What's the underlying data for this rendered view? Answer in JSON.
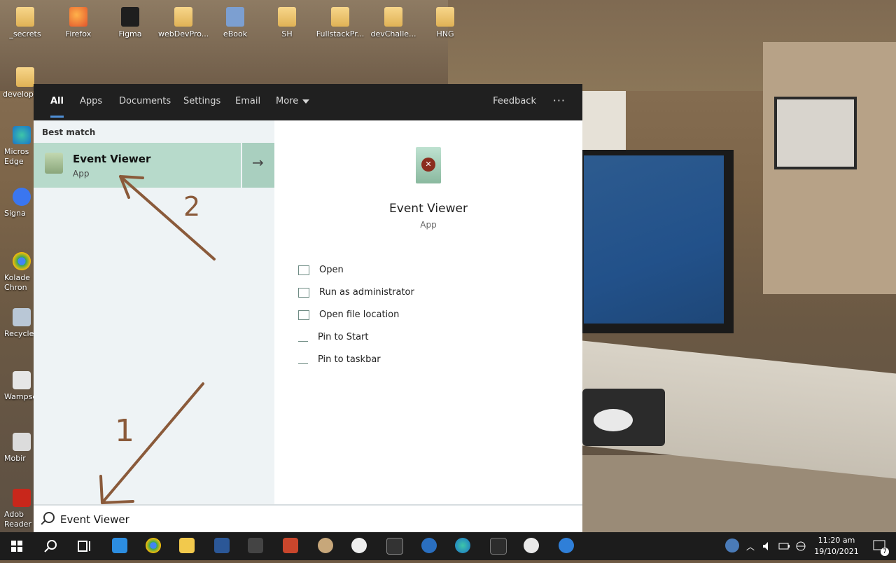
{
  "desktop": {
    "top_icons": [
      {
        "label": "_secrets",
        "icon": "folder-icon"
      },
      {
        "label": "Firefox",
        "icon": "firefox-icon"
      },
      {
        "label": "Figma",
        "icon": "figma-icon"
      },
      {
        "label": "webDevPro...",
        "icon": "folder-icon"
      },
      {
        "label": "eBook",
        "icon": "ebook-icon"
      },
      {
        "label": "SH",
        "icon": "folder-icon"
      },
      {
        "label": "FullstackPr...",
        "icon": "folder-icon"
      },
      {
        "label": "devChalle...",
        "icon": "folder-icon"
      },
      {
        "label": "HNG",
        "icon": "folder-icon"
      }
    ],
    "left_icons": [
      {
        "label": "develop",
        "icon": "folder-icon"
      },
      {
        "label": "Micros Edge",
        "icon": "edge-icon"
      },
      {
        "label": "Signa",
        "icon": "signal-icon"
      },
      {
        "label": "Kolade Chron",
        "icon": "chrome-icon"
      },
      {
        "label": "Recycle",
        "icon": "recycle-bin-icon"
      },
      {
        "label": "Wampse",
        "icon": "wamp-icon"
      },
      {
        "label": "Mobir",
        "icon": "mobirise-icon"
      },
      {
        "label": "Adob Reader",
        "icon": "adobe-reader-icon"
      }
    ]
  },
  "search_panel": {
    "tabs": [
      {
        "label": "All",
        "active": true
      },
      {
        "label": "Apps"
      },
      {
        "label": "Documents"
      },
      {
        "label": "Settings"
      },
      {
        "label": "Email"
      },
      {
        "label": "More"
      }
    ],
    "feedback_label": "Feedback",
    "ellipsis": "···",
    "best_match_heading": "Best match",
    "best_match": {
      "title": "Event Viewer",
      "subtitle": "App",
      "arrow": "→"
    },
    "detail": {
      "title": "Event Viewer",
      "subtitle": "App",
      "actions": [
        {
          "label": "Open",
          "icon": "open-icon"
        },
        {
          "label": "Run as administrator",
          "icon": "shield-icon"
        },
        {
          "label": "Open file location",
          "icon": "file-location-icon"
        },
        {
          "label": "Pin to Start",
          "icon": "pin-icon"
        },
        {
          "label": "Pin to taskbar",
          "icon": "pin-icon"
        }
      ]
    },
    "search": {
      "value": "Event Viewer"
    }
  },
  "annotations": {
    "label_1": "1",
    "label_2": "2",
    "color": "#8a5a3a"
  },
  "taskbar": {
    "apps": [
      "windows-start-icon",
      "search-icon",
      "task-view-icon",
      "vscode-icon",
      "chrome-icon",
      "file-explorer-icon",
      "word-icon",
      "calculator-icon",
      "powerpoint-icon",
      "paint-icon",
      "obs-icon",
      "terminal-icon",
      "unknown-app-icon",
      "edge-icon",
      "powershell-icon",
      "slack-icon",
      "app-icon"
    ],
    "clock_time": "11:20 am",
    "clock_date": "19/10/2021",
    "notification_count": "7"
  }
}
